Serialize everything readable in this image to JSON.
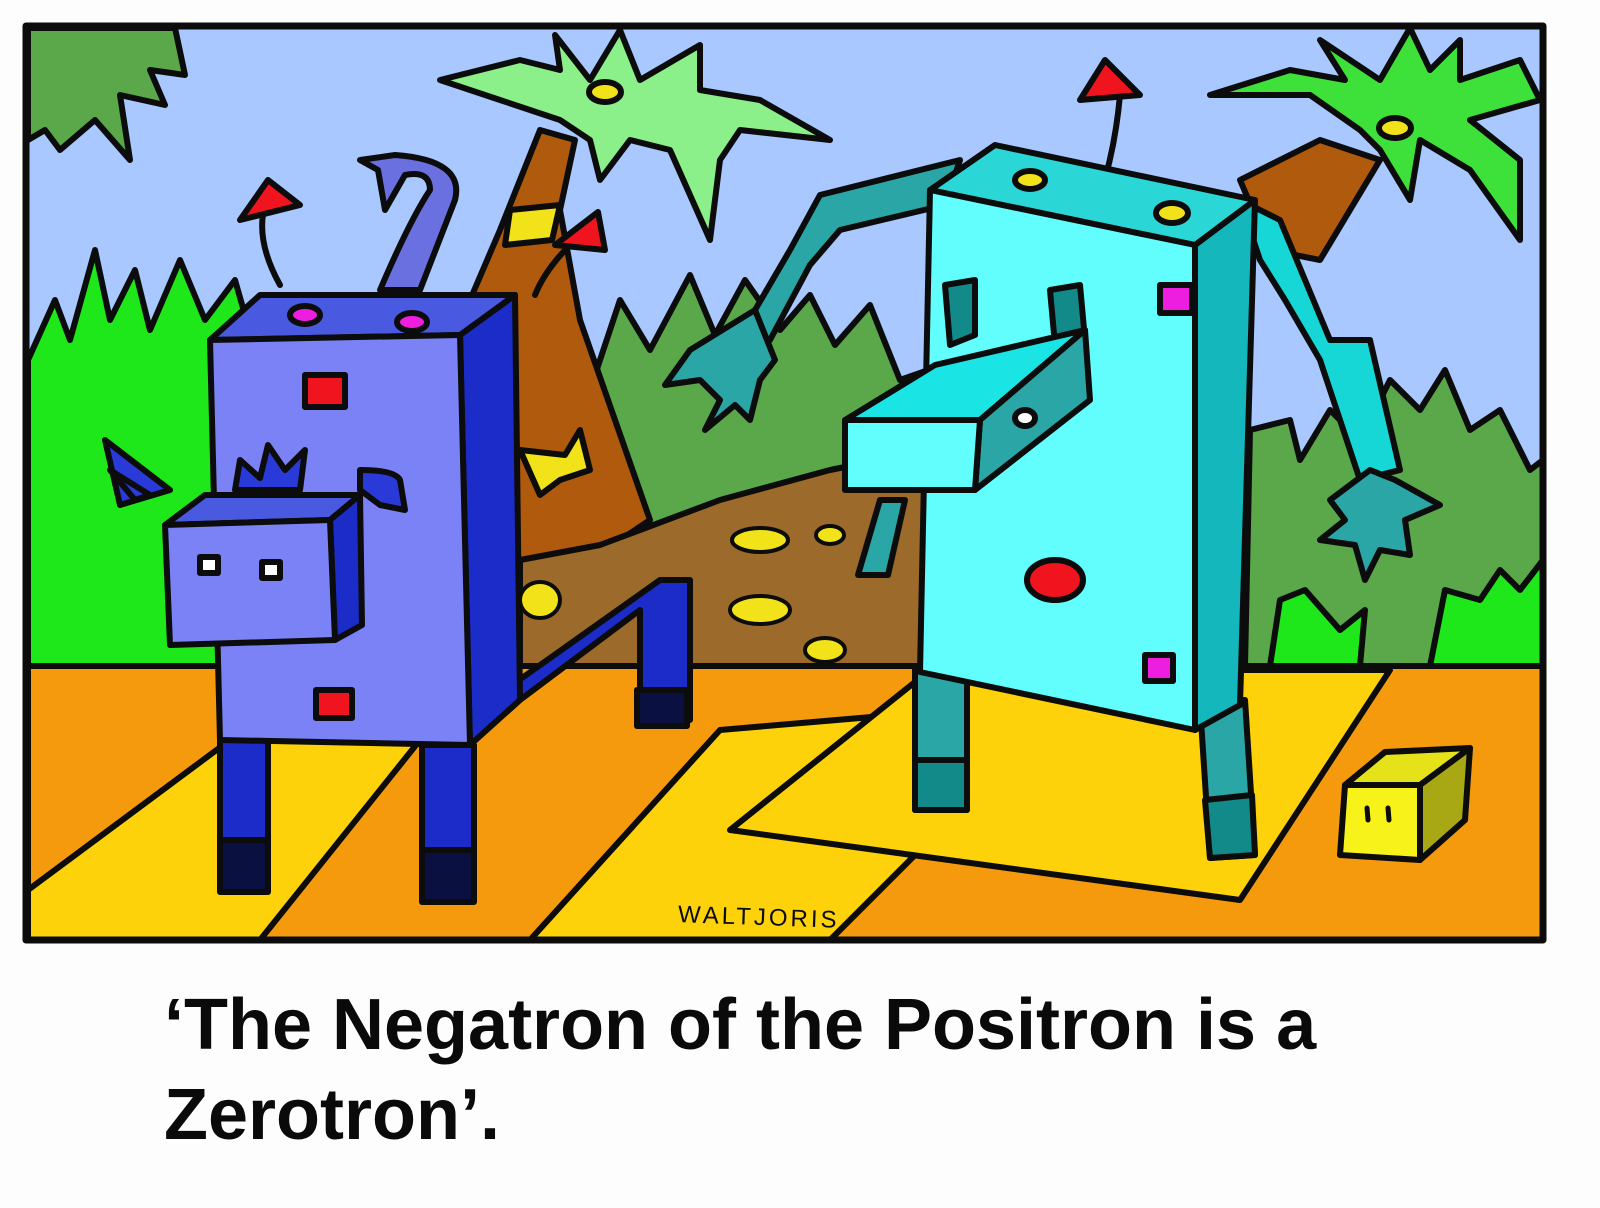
{
  "cartoon": {
    "signature": "WALTJORIS",
    "caption": "‘The Negatron of the Positron is a Zerotron’."
  },
  "colors": {
    "sky": "#a8c8ff",
    "jungle_bright": "#1ee81a",
    "jungle_mid": "#5aa84a",
    "palm_leaf_light": "#8cf08a",
    "palm_leaf_green": "#3ee03a",
    "trunk": "#b05a0e",
    "mound": "#9c6a2a",
    "floor_orange": "#f59a0c",
    "floor_yellow": "#fdd20a",
    "robot_blue_face": "#7b82f5",
    "robot_blue_dark": "#1c2cc8",
    "robot_blue_top": "#4a5ae0",
    "robot_cyan_face": "#62fefe",
    "robot_cyan_side": "#14b8bc",
    "robot_cyan_limb": "#2aa6a6",
    "cube_yellow": "#f7f21a",
    "cube_side": "#a8a814",
    "accent_red": "#f0141e",
    "accent_magenta": "#ee1ee0",
    "outline": "#0c0c0c"
  },
  "icons": [
    "blue-robot",
    "cyan-robot",
    "yellow-cube",
    "palm-tree",
    "volcano-mound"
  ]
}
